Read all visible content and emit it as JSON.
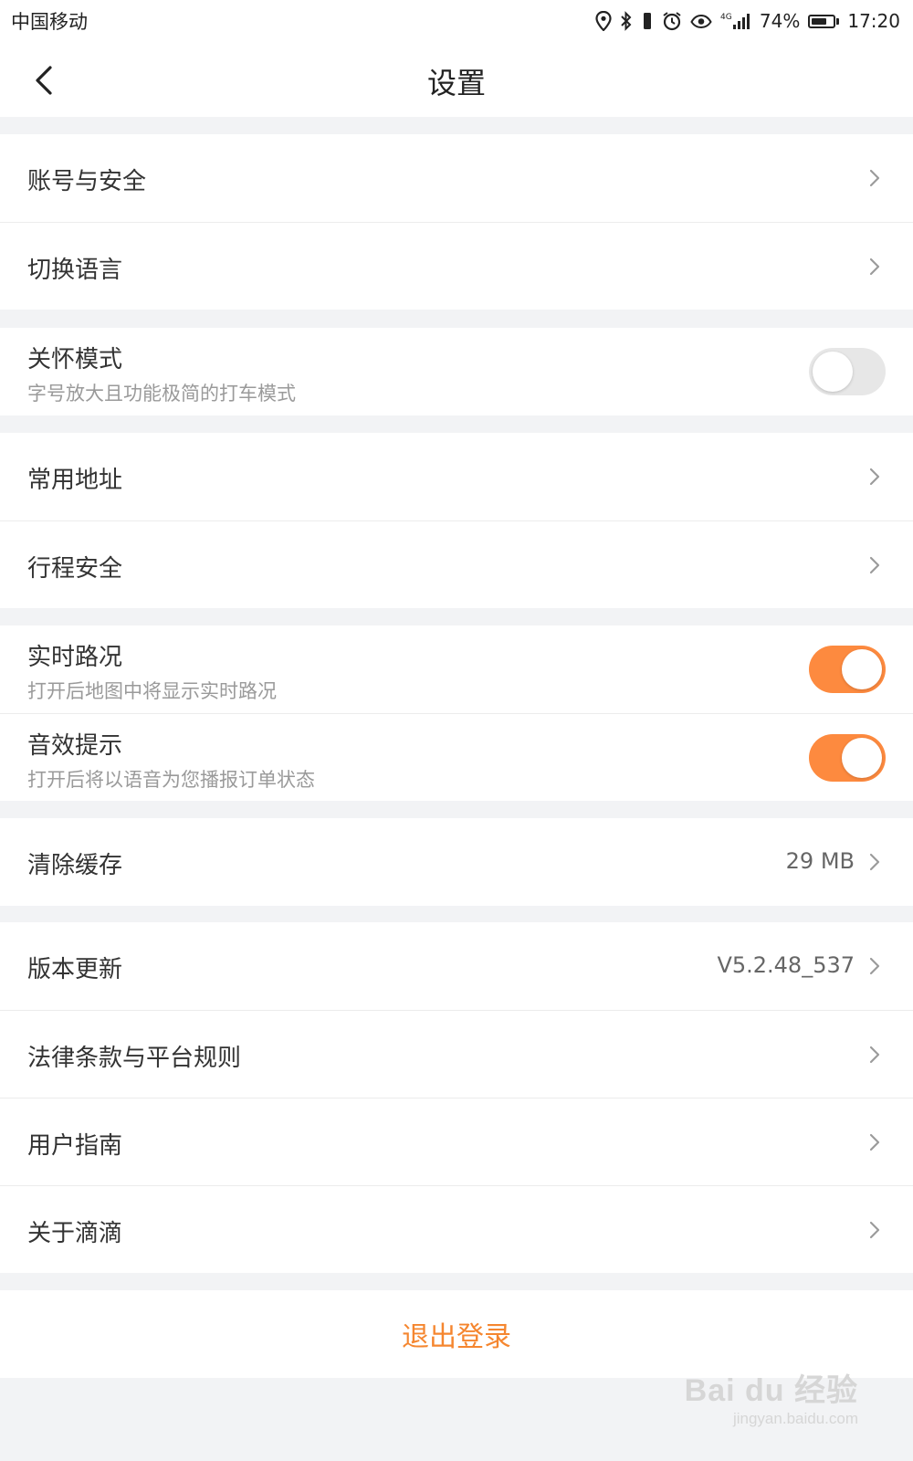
{
  "status_bar": {
    "carrier": "中国移动",
    "network": "4G",
    "battery_percent": "74%",
    "battery_level": 0.74,
    "time": "17:20",
    "icons": [
      "location-icon",
      "bluetooth-icon",
      "vibrate-icon",
      "alarm-icon",
      "eye-icon",
      "signal-icon",
      "battery-icon"
    ]
  },
  "nav": {
    "title": "设置",
    "back_icon": "chevron-left-icon"
  },
  "groups": {
    "account": [
      {
        "label": "账号与安全"
      },
      {
        "label": "切换语言"
      }
    ],
    "care": {
      "label": "关怀模式",
      "sub": "字号放大且功能极简的打车模式",
      "enabled": false
    },
    "places": [
      {
        "label": "常用地址"
      },
      {
        "label": "行程安全"
      }
    ],
    "traffic": {
      "label": "实时路况",
      "sub": "打开后地图中将显示实时路况",
      "enabled": true
    },
    "sound": {
      "label": "音效提示",
      "sub": "打开后将以语音为您播报订单状态",
      "enabled": true
    },
    "cache": {
      "label": "清除缓存",
      "value": "29 MB"
    },
    "about": [
      {
        "label": "版本更新",
        "value": "V5.2.48_537"
      },
      {
        "label": "法律条款与平台规则"
      },
      {
        "label": "用户指南"
      },
      {
        "label": "关于滴滴"
      }
    ]
  },
  "logout_label": "退出登录",
  "colors": {
    "accent": "#f5862f",
    "toggle_on": "#fd8a3f",
    "toggle_off": "#e7e7e7",
    "background": "#f2f3f5"
  },
  "watermark": {
    "brand": "Bai du 经验",
    "url": "jingyan.baidu.com"
  }
}
